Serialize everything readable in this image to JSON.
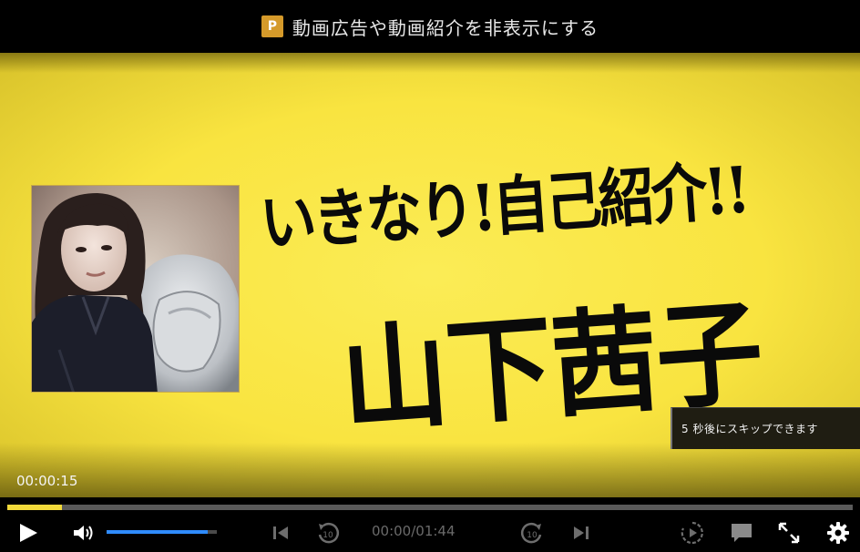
{
  "banner": {
    "icon_letter": "P",
    "text": "動画広告や動画紹介を非表示にする"
  },
  "video": {
    "headline_line1": "いきなり!自己紹介!!",
    "headline_line2": "山下茜子",
    "skip_notice": "5 秒後にスキップできます",
    "elapsed": "00:00:15",
    "colors": {
      "background": "#f9e440",
      "text": "#0a0a0a"
    }
  },
  "controls": {
    "timecode": "00:00/01:44",
    "progress_fraction": 0.065,
    "volume_fraction": 0.92,
    "colors": {
      "progress": "#f2d93a",
      "volume": "#2f8cff"
    },
    "icons": [
      "play-icon",
      "volume-icon",
      "skip-previous-icon",
      "rewind-10-icon",
      "forward-10-icon",
      "skip-next-icon",
      "playback-speed-icon",
      "comment-icon",
      "fullscreen-icon",
      "settings-gear-icon"
    ]
  }
}
